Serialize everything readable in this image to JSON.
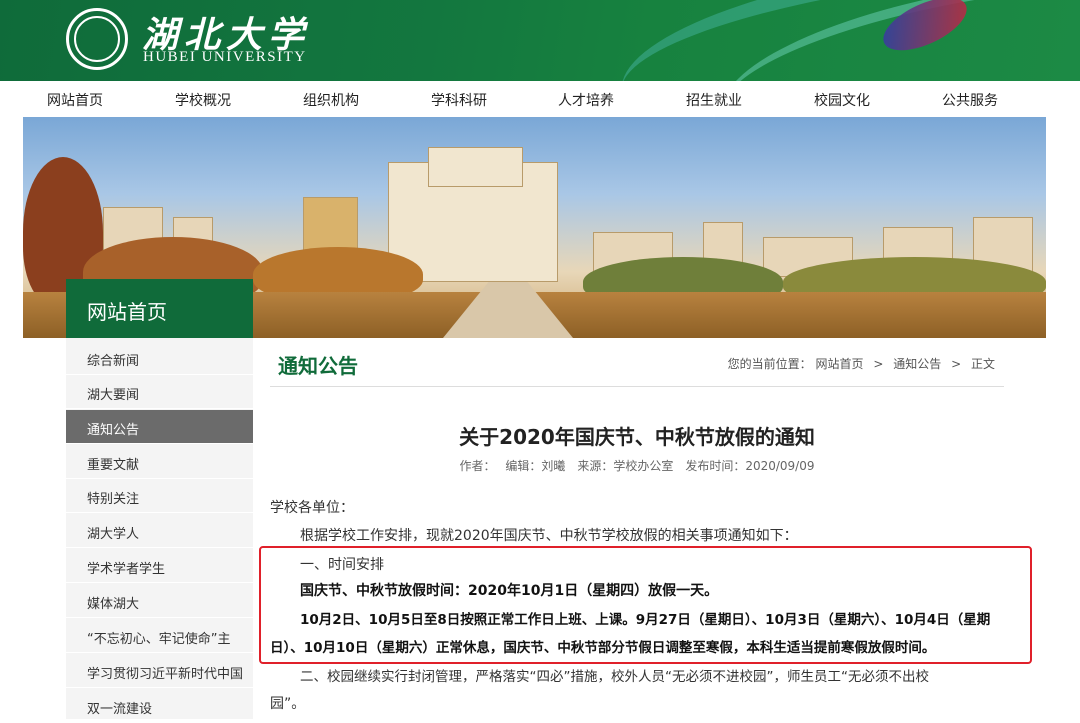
{
  "header": {
    "logo_cn": "湖北大学",
    "logo_en": "HUBEI UNIVERSITY"
  },
  "nav": [
    "网站首页",
    "学校概况",
    "组织机构",
    "学科科研",
    "人才培养",
    "招生就业",
    "校园文化",
    "公共服务"
  ],
  "sidebar": {
    "heading": "网站首页",
    "items": [
      "综合新闻",
      "湖大要闻",
      "通知公告",
      "重要文献",
      "特别关注",
      "湖大学人",
      "学术学者学生",
      "媒体湖大",
      "“不忘初心、牢记使命”主",
      "学习贯彻习近平新时代中国",
      "双一流建设"
    ],
    "active_index": 2
  },
  "section": {
    "title": "通知公告",
    "breadcrumb_prefix": "您的当前位置：",
    "crumbs": [
      "网站首页",
      "通知公告",
      "正文"
    ],
    "separator": ">"
  },
  "article": {
    "title": "关于2020年国庆节、中秋节放假的通知",
    "meta": "作者：　 编辑：刘曦　来源：学校办公室　发布时间：2020/09/09",
    "paragraphs": [
      "学校各单位：",
      "根据学校工作安排，现就2020年国庆节、中秋节学校放假的相关事项通知如下：",
      "一、时间安排",
      "国庆节、中秋节放假时间：2020年10月1日（星期四）放假一天。",
      "10月2日、10月5日至8日按照正常工作日上班、上课。9月27日（星期日）、10月3日（星期六）、10月4日（星期",
      "日）、10月10日（星期六）正常休息，国庆节、中秋节部分节假日调整至寒假，本科生适当提前寒假放假时间。",
      "二、校园继续实行封闭管理，严格落实“四必”措施，校外人员“无必须不进校园”，师生员工“无必须不出校",
      "园”。"
    ]
  },
  "colors": {
    "brand_green": "#106b3a",
    "highlight_red": "#e0202a",
    "active_gray": "#6b6b6b"
  }
}
